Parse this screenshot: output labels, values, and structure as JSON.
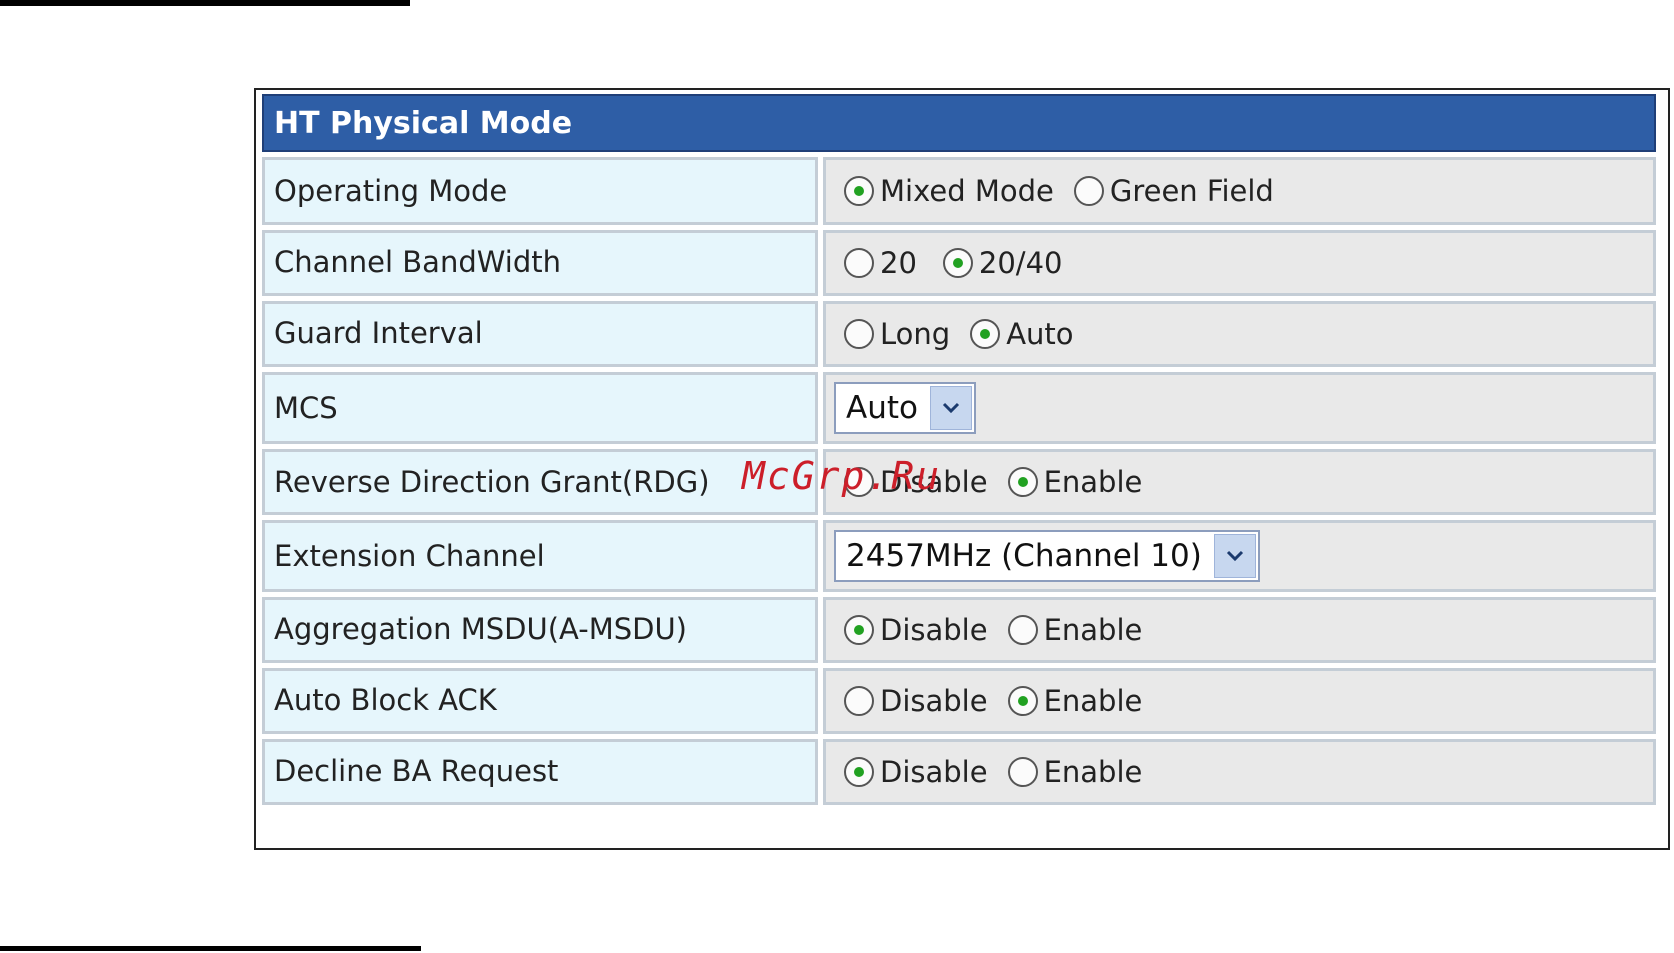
{
  "header": {
    "title": "HT Physical Mode"
  },
  "watermark": "McGrp.Ru",
  "rows": {
    "operating_mode": {
      "label": "Operating Mode",
      "options": [
        "Mixed Mode",
        "Green Field"
      ],
      "selected": "Mixed Mode"
    },
    "channel_bandwidth": {
      "label": "Channel BandWidth",
      "options": [
        "20",
        "20/40"
      ],
      "selected": "20/40"
    },
    "guard_interval": {
      "label": "Guard Interval",
      "options": [
        "Long",
        "Auto"
      ],
      "selected": "Auto"
    },
    "mcs": {
      "label": "MCS",
      "value": "Auto"
    },
    "rdg": {
      "label": "Reverse Direction Grant(RDG)",
      "options": [
        "Disable",
        "Enable"
      ],
      "selected": "Enable"
    },
    "extension_channel": {
      "label": "Extension Channel",
      "value": "2457MHz (Channel 10)"
    },
    "amsdu": {
      "label": "Aggregation MSDU(A-MSDU)",
      "options": [
        "Disable",
        "Enable"
      ],
      "selected": "Disable"
    },
    "auto_block_ack": {
      "label": "Auto Block ACK",
      "options": [
        "Disable",
        "Enable"
      ],
      "selected": "Enable"
    },
    "decline_ba": {
      "label": "Decline BA Request",
      "options": [
        "Disable",
        "Enable"
      ],
      "selected": "Disable"
    }
  },
  "colors": {
    "header_bg": "#2e5ea6",
    "label_bg": "#e6f6fc",
    "value_bg": "#e9e9e9",
    "radio_selected": "#21a121",
    "watermark": "#cc1f2a"
  }
}
